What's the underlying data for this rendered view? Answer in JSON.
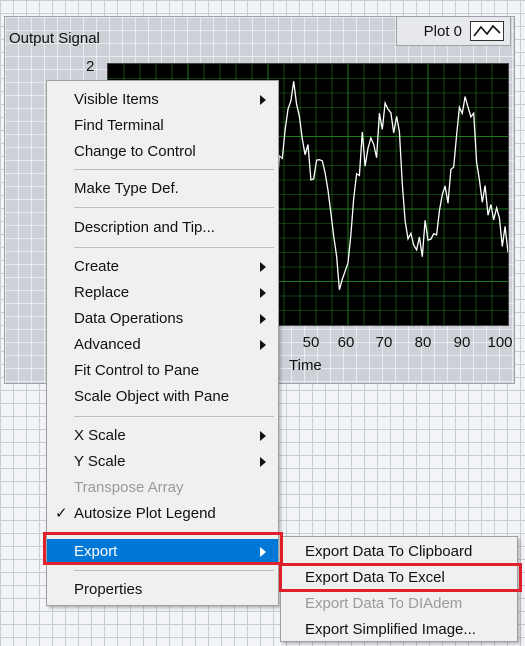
{
  "graph": {
    "label": "Output Signal",
    "legend_plot_name": "Plot 0",
    "y_tick_top": "2",
    "x_axis_label": "Time",
    "x_ticks": [
      "50",
      "60",
      "70",
      "80",
      "90",
      "100"
    ],
    "plot_background": "#000000",
    "grid_color": "#1f7a1f",
    "signal_color": "#ffffff"
  },
  "context_menu": {
    "visible_items": "Visible Items",
    "find_terminal": "Find Terminal",
    "change_to_control": "Change to Control",
    "make_type_def": "Make Type Def.",
    "description_and_tip": "Description and Tip...",
    "create": "Create",
    "replace": "Replace",
    "data_operations": "Data Operations",
    "advanced": "Advanced",
    "fit_control_to_pane": "Fit Control to Pane",
    "scale_object_with_pane": "Scale Object with Pane",
    "x_scale": "X Scale",
    "y_scale": "Y Scale",
    "transpose_array": "Transpose Array",
    "autosize_plot_legend": "Autosize Plot Legend",
    "autosize_checked": true,
    "export": "Export",
    "properties": "Properties",
    "highlight_color": "#0078d7"
  },
  "export_submenu": {
    "clipboard": "Export Data To Clipboard",
    "excel": "Export Data To Excel",
    "diadem": "Export Data To DIAdem",
    "simplified_image": "Export Simplified Image..."
  },
  "annotation_color": "#e0202a"
}
